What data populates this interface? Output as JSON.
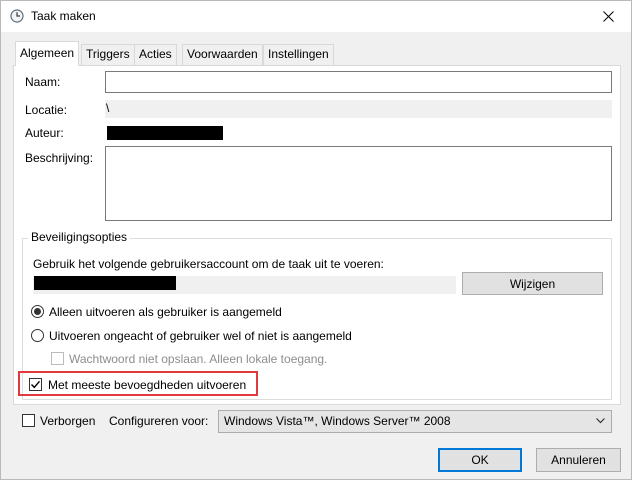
{
  "window": {
    "title": "Taak maken",
    "icons": {
      "app": "clock-icon",
      "close": "close-icon"
    }
  },
  "tabs": [
    {
      "label": "Algemeen",
      "selected": true
    },
    {
      "label": "Triggers",
      "selected": false
    },
    {
      "label": "Acties",
      "selected": false
    },
    {
      "label": "Voorwaarden",
      "selected": false
    },
    {
      "label": "Instellingen",
      "selected": false
    }
  ],
  "general": {
    "name_label": "Naam:",
    "name_value": "",
    "location_label": "Locatie:",
    "location_value": "\\",
    "author_label": "Auteur:",
    "description_label": "Beschrijving:",
    "description_value": ""
  },
  "security": {
    "title": "Beveiligingsopties",
    "account_prompt": "Gebruik het volgende gebruikersaccount om de taak uit te voeren:",
    "change_button": "Wijzigen",
    "radio_logged_on": "Alleen uitvoeren als gebruiker is aangemeld",
    "radio_logged_on_selected": true,
    "radio_any": "Uitvoeren ongeacht of gebruiker wel of niet is aangemeld",
    "radio_any_selected": false,
    "no_store_password": "Wachtwoord niet opslaan. Alleen lokale toegang.",
    "no_store_password_checked": false,
    "no_store_password_enabled": false,
    "highest_privileges": "Met meeste bevoegdheden uitvoeren",
    "highest_privileges_checked": true
  },
  "footer": {
    "hidden_label": "Verborgen",
    "hidden_checked": false,
    "configure_label": "Configureren voor:",
    "configure_value": "Windows Vista™, Windows Server™ 2008",
    "ok_button": "OK",
    "cancel_button": "Annuleren"
  },
  "colors": {
    "highlight_box": "#e0393e",
    "default_button_border": "#0078d7"
  }
}
